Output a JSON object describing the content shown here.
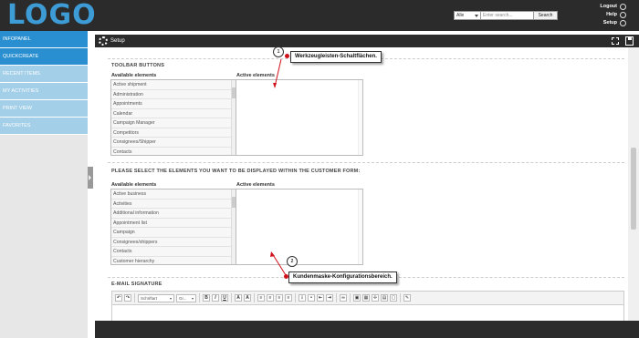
{
  "topbar": {
    "logo": "LOGO",
    "search": {
      "select_value": "Alle",
      "placeholder": "Enter search...",
      "button": "Search"
    },
    "links": [
      {
        "label": "Logout",
        "icon": "power-icon"
      },
      {
        "label": "Help",
        "icon": "help-icon"
      },
      {
        "label": "Setup",
        "icon": "gear-icon"
      }
    ]
  },
  "sidebar": {
    "items": [
      {
        "label": "INFOPANEL"
      },
      {
        "label": "QUICKCREATE"
      },
      {
        "label": "RECENT ITEMS"
      },
      {
        "label": "MY ACTIVITIES"
      },
      {
        "label": "PRINT VIEW"
      },
      {
        "label": "FAVORITES"
      }
    ]
  },
  "panel": {
    "title": "Setup"
  },
  "toolbar_section": {
    "title": "TOOLBAR BUTTONS",
    "available_label": "Available elements",
    "active_label": "Active elements",
    "available": [
      "Active shipment",
      "Administration",
      "Appointments",
      "Calendar",
      "Campaign Manager",
      "Competitors",
      "Consignees/Shipper",
      "Contacts"
    ]
  },
  "customer_section": {
    "title": "PLEASE SELECT THE ELEMENTS YOU WANT TO BE DISPLAYED WITHIN THE CUSTOMER FORM:",
    "available_label": "Available elements",
    "active_label": "Active elements",
    "available": [
      "Active business",
      "Activities",
      "Additional information",
      "Appointment list",
      "Campaign",
      "Consignees/shippers",
      "Contacts",
      "Customer hierarchy"
    ]
  },
  "email_section": {
    "title": "E-MAIL SIGNATURE",
    "font_select": "Schriftart",
    "size_select": "Gr..."
  },
  "callouts": [
    {
      "number": "1",
      "text": "Werkzeugleisten-Schaltflächen."
    },
    {
      "number": "2",
      "text": "Kundenmaske-Konfigurationsbereich."
    }
  ],
  "colors": {
    "accent": "#2a8fd0",
    "light_accent": "#a3cfe8",
    "topbar": "#2b2b2b",
    "callout_dot": "#d0101a"
  }
}
